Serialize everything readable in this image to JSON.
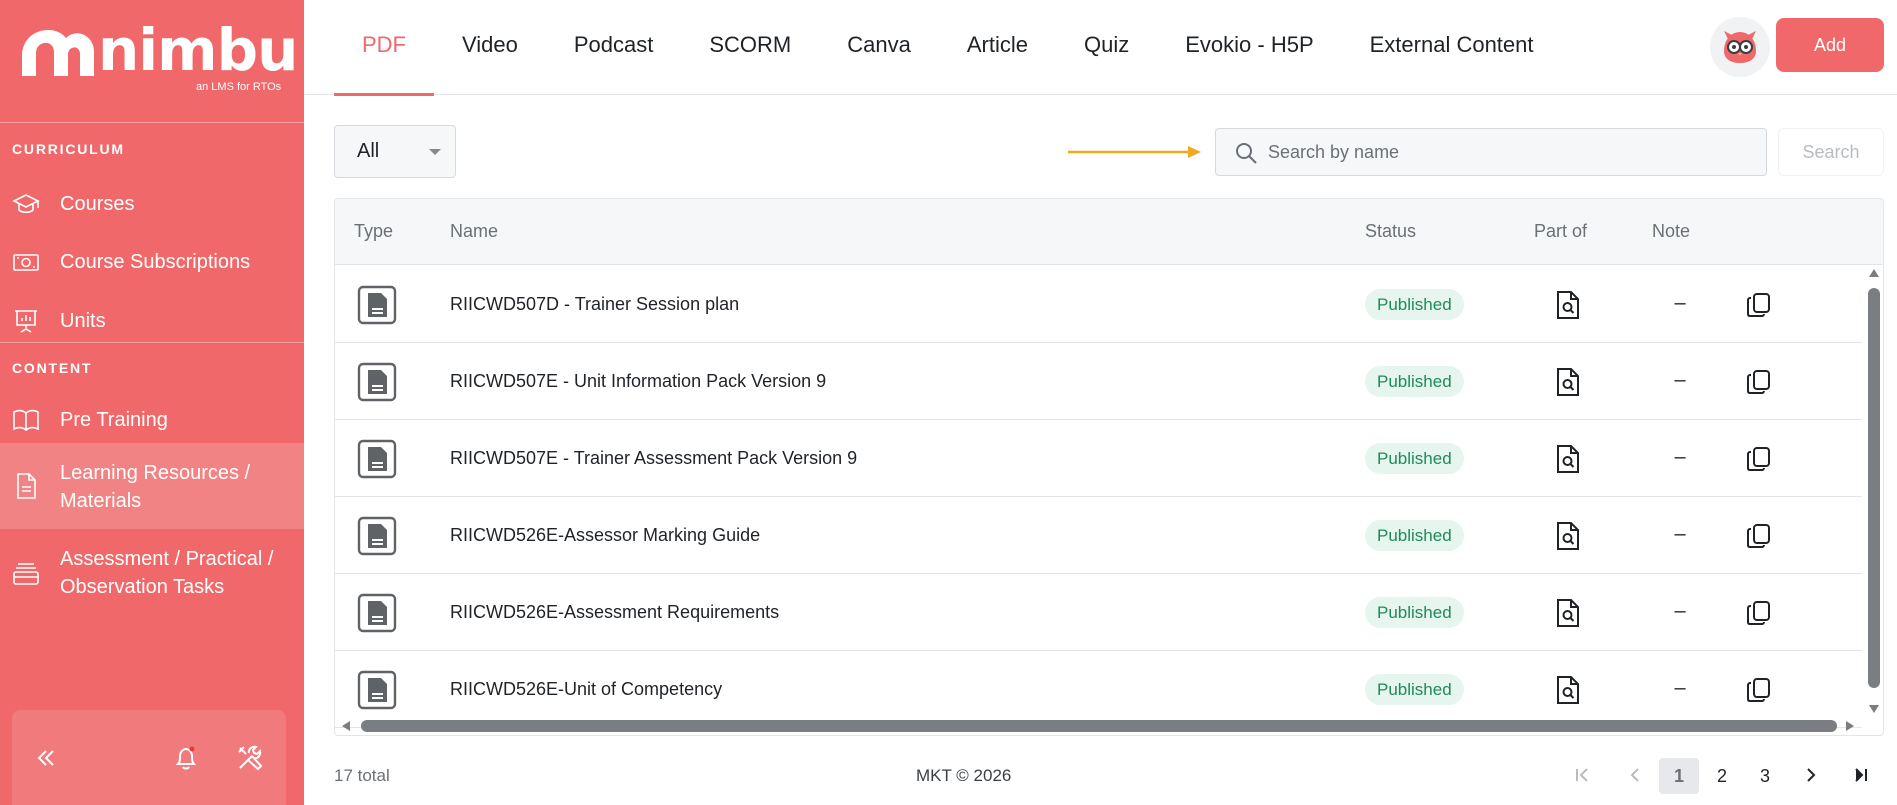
{
  "brand": {
    "name": "nimbu",
    "tagline": "an LMS for RTOs",
    "accent": "#f0686a"
  },
  "sidebar": {
    "sections": [
      {
        "label": "CURRICULUM"
      },
      {
        "label": "CONTENT"
      }
    ],
    "items": [
      {
        "label": "Courses",
        "icon": "graduation-cap-icon"
      },
      {
        "label": "Course Subscriptions",
        "icon": "money-icon"
      },
      {
        "label": "Units",
        "icon": "presentation-board-icon"
      },
      {
        "label": "Pre Training",
        "icon": "open-book-icon"
      },
      {
        "label_line1": "Learning Resources /",
        "label_line2": "Materials",
        "icon": "document-icon",
        "active": true
      },
      {
        "label_line1": "Assessment / Practical /",
        "label_line2": "Observation Tasks",
        "icon": "stack-icon"
      }
    ]
  },
  "tabs": [
    {
      "label": "PDF",
      "active": true
    },
    {
      "label": "Video"
    },
    {
      "label": "Podcast"
    },
    {
      "label": "SCORM"
    },
    {
      "label": "Canva"
    },
    {
      "label": "Article"
    },
    {
      "label": "Quiz"
    },
    {
      "label": "Evokio - H5P"
    },
    {
      "label": "External Content"
    }
  ],
  "header": {
    "add_label": "Add"
  },
  "filter": {
    "selected": "All"
  },
  "search": {
    "placeholder": "Search by name",
    "value": "",
    "button_label": "Search"
  },
  "table": {
    "columns": {
      "type": "Type",
      "name": "Name",
      "status": "Status",
      "part_of": "Part of",
      "note": "Note"
    },
    "rows": [
      {
        "name": "RIICWD507D - Trainer Session plan",
        "status": "Published",
        "note": "–"
      },
      {
        "name": "RIICWD507E - Unit Information Pack Version 9",
        "status": "Published",
        "note": "–"
      },
      {
        "name": "RIICWD507E - Trainer Assessment Pack Version 9",
        "status": "Published",
        "note": "–"
      },
      {
        "name": "RIICWD526E-Assessor Marking Guide",
        "status": "Published",
        "note": "–"
      },
      {
        "name": "RIICWD526E-Assessment Requirements",
        "status": "Published",
        "note": "–"
      },
      {
        "name": "RIICWD526E-Unit of Competency",
        "status": "Published",
        "note": "–"
      }
    ]
  },
  "footer": {
    "total": "17 total",
    "copyright": "MKT © 2026",
    "pages": [
      "1",
      "2",
      "3"
    ],
    "current_page": "1"
  }
}
